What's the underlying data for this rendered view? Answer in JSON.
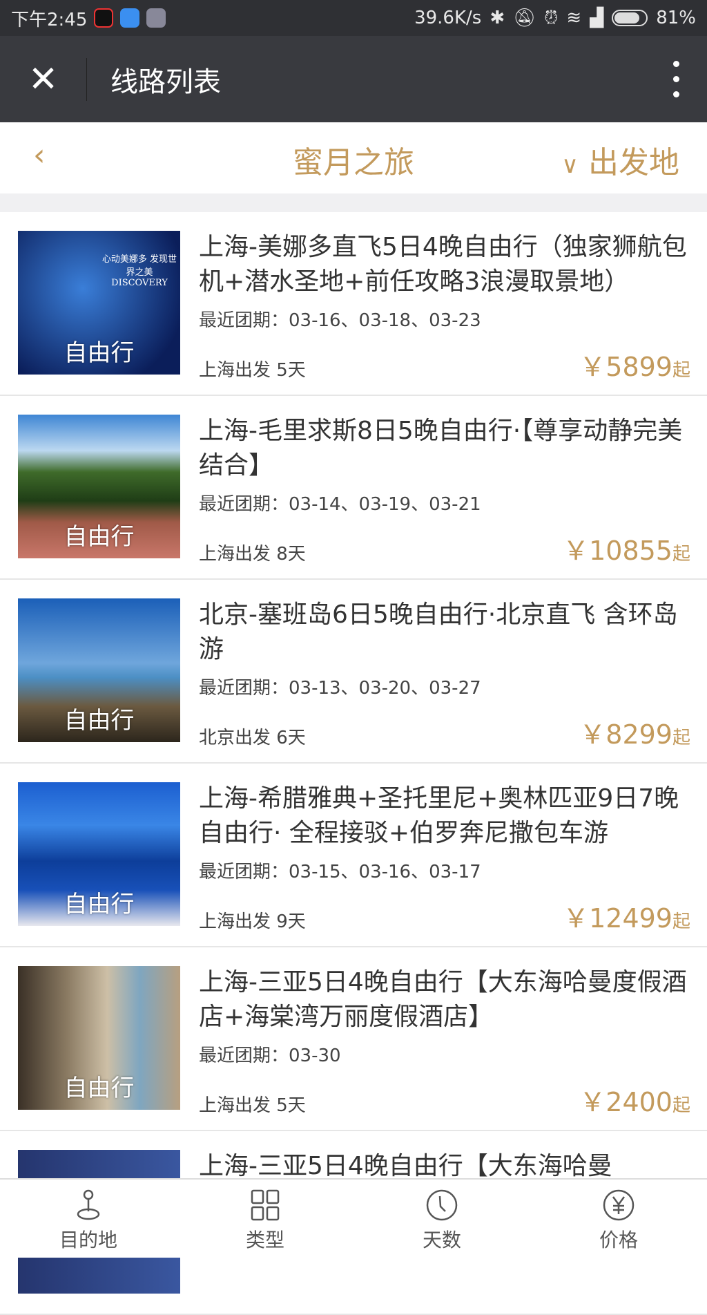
{
  "status": {
    "time": "下午2:45",
    "speed": "39.6K/s",
    "battery": "81%"
  },
  "titlebar": {
    "title": "线路列表"
  },
  "subheader": {
    "back": "‹",
    "category": "蜜月之旅",
    "departure_filter": "出发地"
  },
  "items": [
    {
      "title": "上海-美娜多直飞5日4晚自由行（独家狮航包机+潜水圣地+前任攻略3浪漫取景地）",
      "dates": "最近团期：03-16、03-18、03-23",
      "origin": "上海出发 5天",
      "price": "￥5899",
      "suffix": "起",
      "tag": "自由行",
      "thumb_text": "心动美娜多 发现世界之美 DISCOVERY"
    },
    {
      "title": "上海-毛里求斯8日5晚自由行·【尊享动静完美结合】",
      "dates": "最近团期：03-14、03-19、03-21",
      "origin": "上海出发 8天",
      "price": "￥10855",
      "suffix": "起",
      "tag": "自由行"
    },
    {
      "title": "北京-塞班岛6日5晚自由行·北京直飞 含环岛游",
      "dates": "最近团期：03-13、03-20、03-27",
      "origin": "北京出发 6天",
      "price": "￥8299",
      "suffix": "起",
      "tag": "自由行"
    },
    {
      "title": "上海-希腊雅典+圣托里尼+奥林匹亚9日7晚自由行· 全程接驳+伯罗奔尼撒包车游",
      "dates": "最近团期：03-15、03-16、03-17",
      "origin": "上海出发 9天",
      "price": "￥12499",
      "suffix": "起",
      "tag": "自由行"
    },
    {
      "title": "上海-三亚5日4晚自由行【大东海哈曼度假酒店+海棠湾万丽度假酒店】",
      "dates": "最近团期：03-30",
      "origin": "上海出发 5天",
      "price": "￥2400",
      "suffix": "起",
      "tag": "自由行"
    },
    {
      "title": "上海-三亚5日4晚自由行【大东海哈曼"
    }
  ],
  "nav": [
    {
      "label": "目的地",
      "icon": "location-pin-icon"
    },
    {
      "label": "类型",
      "icon": "grid-icon"
    },
    {
      "label": "天数",
      "icon": "clock-icon"
    },
    {
      "label": "价格",
      "icon": "yuan-icon"
    }
  ],
  "colors": {
    "accent": "#c39a5c",
    "titlebar": "#393a3f"
  }
}
